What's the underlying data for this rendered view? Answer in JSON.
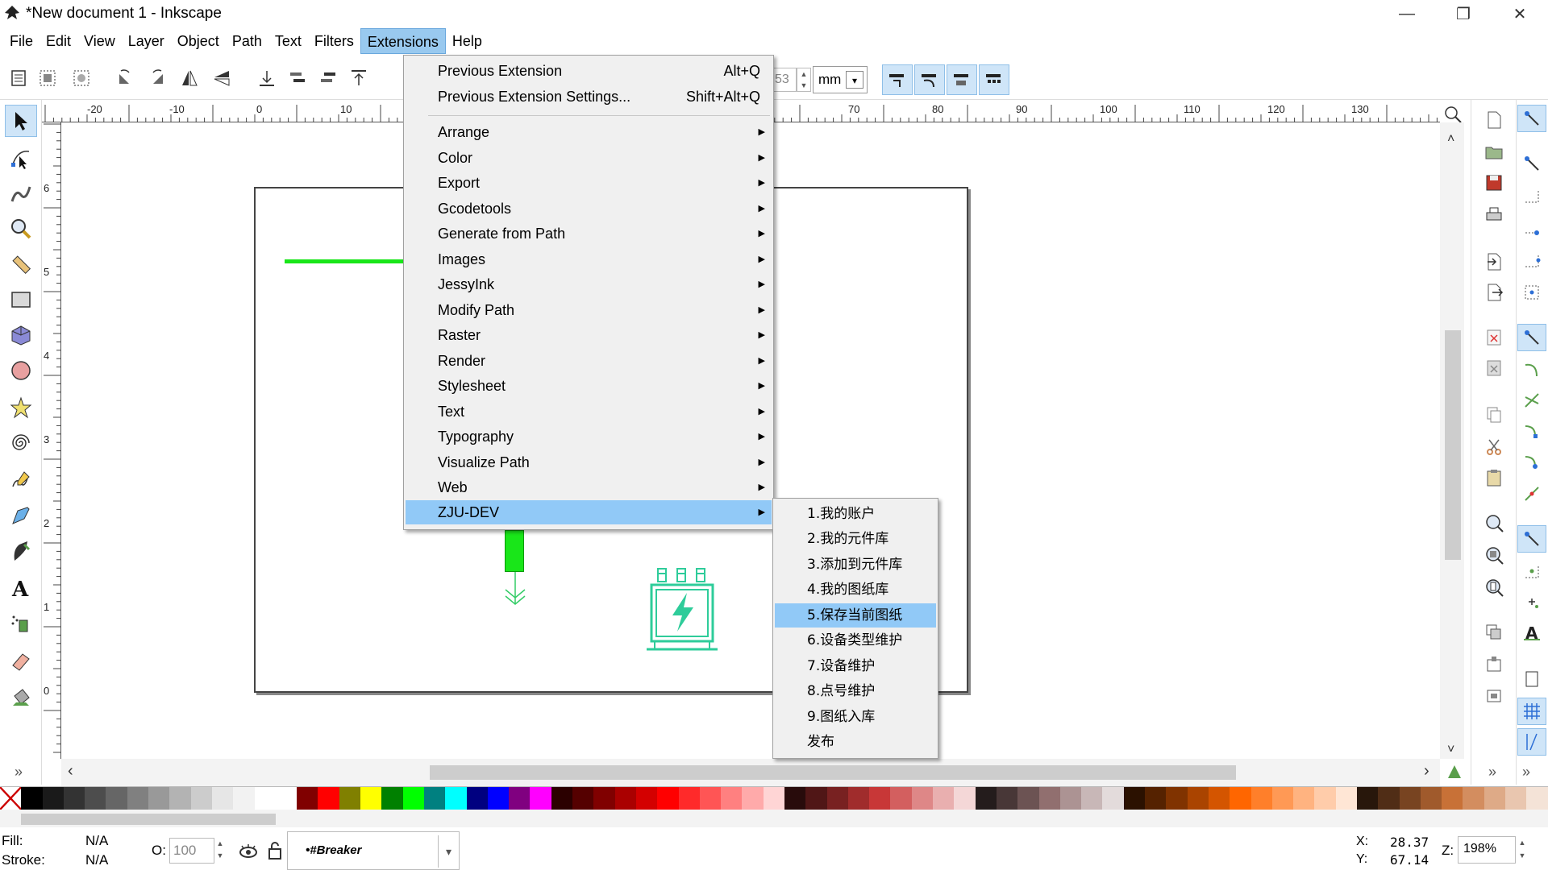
{
  "window": {
    "title": "*New document 1 - Inkscape",
    "minimize": "—",
    "restore": "❐",
    "close": "✕"
  },
  "menubar": [
    "File",
    "Edit",
    "View",
    "Layer",
    "Object",
    "Path",
    "Text",
    "Filters",
    "Extensions",
    "Help"
  ],
  "toolbar": {
    "field_value": "53",
    "unit": "mm"
  },
  "extensions_menu": {
    "previous_extension": "Previous Extension",
    "previous_extension_shortcut": "Alt+Q",
    "previous_extension_settings": "Previous Extension Settings...",
    "previous_extension_settings_shortcut": "Shift+Alt+Q",
    "submenus": [
      "Arrange",
      "Color",
      "Export",
      "Gcodetools",
      "Generate from Path",
      "Images",
      "JessyInk",
      "Modify Path",
      "Raster",
      "Render",
      "Stylesheet",
      "Text",
      "Typography",
      "Visualize Path",
      "Web",
      "ZJU-DEV"
    ],
    "highlighted": "ZJU-DEV"
  },
  "zju_dev_menu": {
    "items": [
      "1.我的账户",
      "2.我的元件库",
      "3.添加到元件库",
      "4.我的图纸库",
      "5.保存当前图纸",
      "6.设备类型维护",
      "7.设备维护",
      "8.点号维护",
      "9.图纸入库",
      "发布"
    ],
    "highlighted": "5.保存当前图纸"
  },
  "rulers": {
    "h_labels": [
      "-20",
      "-10",
      "0",
      "10",
      "70",
      "80",
      "90",
      "100",
      "110",
      "120",
      "130"
    ],
    "v_labels": [
      "6",
      "5",
      "4",
      "3",
      "2",
      "1",
      "0"
    ]
  },
  "status": {
    "fill_label": "Fill:",
    "fill_value": "N/A",
    "stroke_label": "Stroke:",
    "stroke_value": "N/A",
    "opacity_label": "O:",
    "opacity_value": "100",
    "layer": "•#Breaker",
    "x_label": "X:",
    "x_value": "28.37",
    "y_label": "Y:",
    "y_value": "67.14",
    "zoom_label": "Z:",
    "zoom_value": "198%"
  },
  "colors": {
    "accent": "#99c9ef",
    "menu_highlight": "#91c9f7",
    "green_line": "#19e619",
    "icon_teal": "#2ecc9a"
  },
  "icons": {
    "expand_tools": "»",
    "scroll_left": "‹",
    "scroll_right": "›",
    "scroll_up": "˄",
    "scroll_down": "˅"
  }
}
